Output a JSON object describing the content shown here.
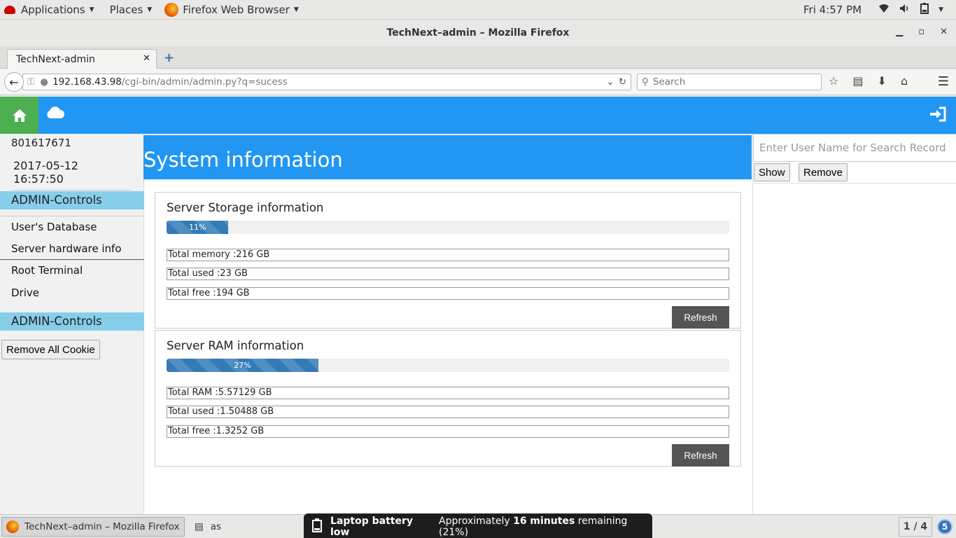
{
  "topbar": {
    "applications": "Applications",
    "places": "Places",
    "firefox": "Firefox Web Browser",
    "clock": "Fri  4:57 PM"
  },
  "window": {
    "title": "TechNext–admin – Mozilla Firefox"
  },
  "browser": {
    "tab_label": "TechNext-admin",
    "url_host": "192.168.43.98",
    "url_path": "/cgi-bin/admin/admin.py?q=sucess",
    "search_placeholder": "Search"
  },
  "sidebar": {
    "number": "801617671",
    "datetime": "2017-05-12 16:57:50",
    "section1": "ADMIN-Controls",
    "links": [
      "User's Database",
      "Server hardware info",
      "Root Terminal",
      "Drive"
    ],
    "section2": "ADMIN-Controls",
    "remove_cookie": "Remove All Cookie"
  },
  "main": {
    "heading": "System information",
    "storage": {
      "title": "Server Storage information",
      "percent_label": "11%",
      "percent": 11,
      "rows": [
        "Total memory :216 GB",
        "Total used :23 GB",
        "Total free :194 GB"
      ],
      "refresh": "Refresh"
    },
    "ram": {
      "title": "Server RAM information",
      "percent_label": "27%",
      "percent": 27,
      "rows": [
        "Total RAM :5.57129 GB",
        "Total used :1.50488 GB",
        "Total free :1.3252 GB"
      ],
      "refresh": "Refresh"
    }
  },
  "rightpanel": {
    "search_placeholder": "Enter User Name for Search Record",
    "show": "Show",
    "remove": "Remove"
  },
  "taskbar": {
    "task1": "TechNext–admin – Mozilla Firefox",
    "task2": "as",
    "workspace": "1 / 4",
    "notif_count": "5"
  },
  "notification": {
    "title": "Laptop battery low",
    "body_prefix": "Approximately ",
    "body_bold": "16 minutes",
    "body_suffix": " remaining (21%)"
  },
  "colors": {
    "appbar": "#2196f3",
    "home": "#4caf50",
    "sidebar_header": "#87ceeb",
    "progress": "#337ab7",
    "refresh_button": "#555555"
  }
}
